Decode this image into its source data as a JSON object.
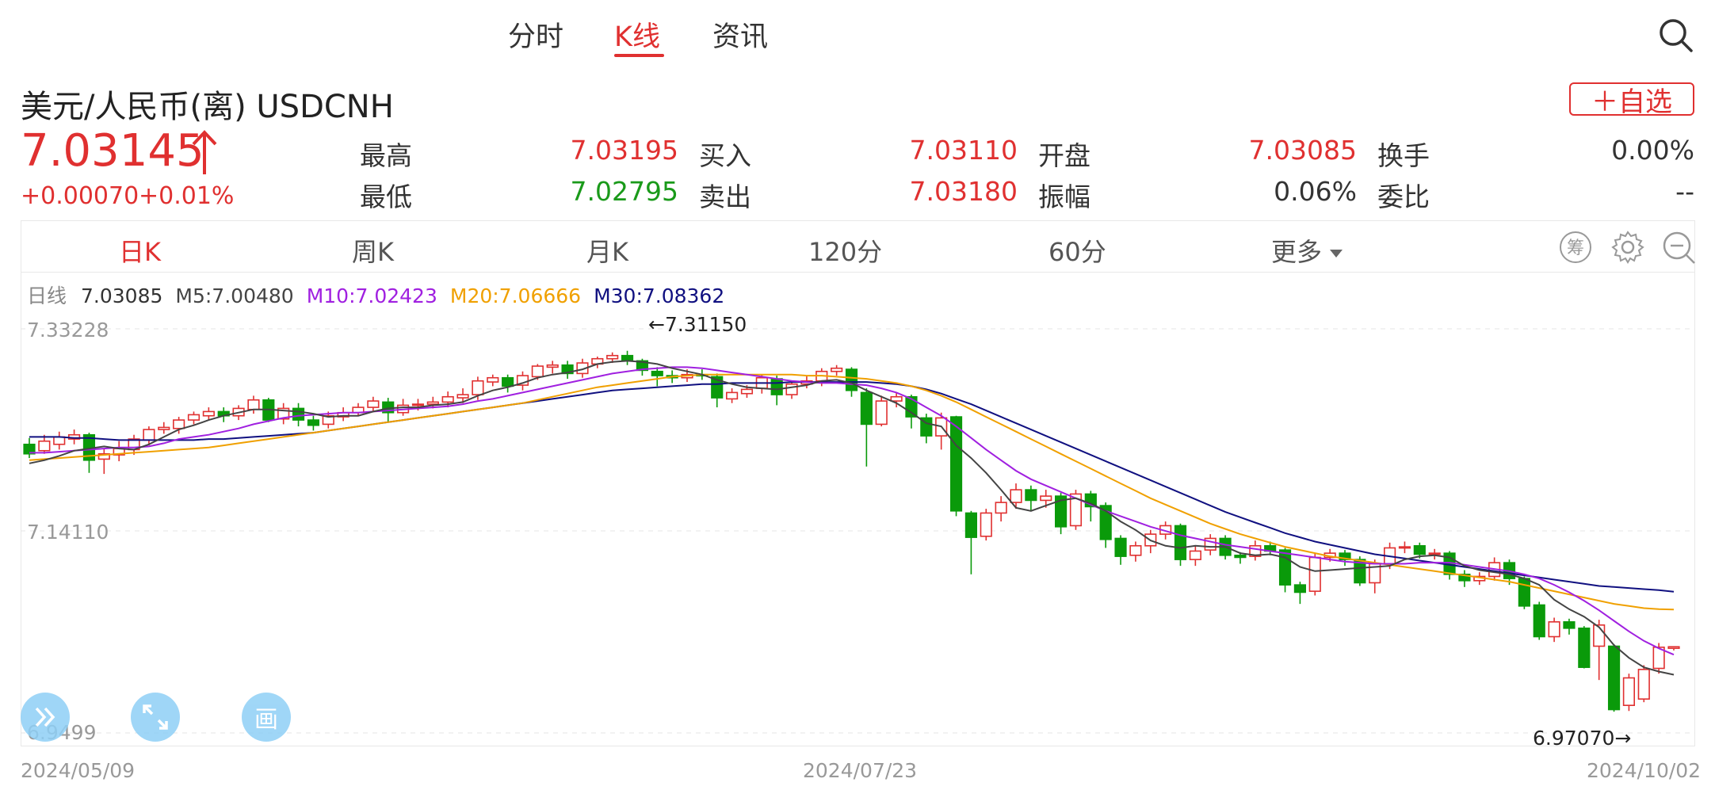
{
  "top_tabs": [
    {
      "label": "分时",
      "active": false
    },
    {
      "label": "K线",
      "active": true
    },
    {
      "label": "资讯",
      "active": false
    }
  ],
  "header": {
    "title": "美元/人民币(离) USDCNH",
    "favorite_label": "＋自选",
    "price": "7.03145",
    "change_abs": "+0.00070",
    "change_pct": "+0.01%"
  },
  "quote": {
    "high": {
      "label": "最高",
      "value": "7.03195"
    },
    "low": {
      "label": "最低",
      "value": "7.02795"
    },
    "bid": {
      "label": "买入",
      "value": "7.03110"
    },
    "ask": {
      "label": "卖出",
      "value": "7.03180"
    },
    "open": {
      "label": "开盘",
      "value": "7.03085"
    },
    "amplitude": {
      "label": "振幅",
      "value": "0.06%"
    },
    "turnover": {
      "label": "换手",
      "value": "0.00%"
    },
    "ratio": {
      "label": "委比",
      "value": "--"
    }
  },
  "periods": [
    {
      "label": "日K",
      "active": true
    },
    {
      "label": "周K",
      "active": false
    },
    {
      "label": "月K",
      "active": false
    },
    {
      "label": "120分",
      "active": false
    },
    {
      "label": "60分",
      "active": false
    },
    {
      "label": "更多",
      "active": false
    }
  ],
  "tools": {
    "chip_icon_text": "筹"
  },
  "ma_legend": {
    "label": "日线",
    "value": "7.03085",
    "m5": "M5:7.00480",
    "m10": "M10:7.02423",
    "m20": "M20:7.06666",
    "m30": "M30:7.08362"
  },
  "colors": {
    "up": "#e03030",
    "down": "#0a9a0a",
    "m5": "#444444",
    "m10": "#a020e0",
    "m20": "#f0a000",
    "m30": "#101080"
  },
  "float_buttons": {
    "draw_label": "画"
  },
  "chart_data": {
    "type": "candlestick",
    "y_top_label": "7.33228",
    "y_mid_label": "7.14110",
    "y_bottom_label": "6.9499",
    "ylim": [
      6.9499,
      7.33228
    ],
    "x_labels": [
      "2024/05/09",
      "2024/07/23",
      "2024/10/02"
    ],
    "max_annotation": "←7.31150",
    "min_annotation": "6.97070→",
    "candles": [
      [
        7.223,
        7.214,
        7.229,
        7.21
      ],
      [
        7.217,
        7.226,
        7.232,
        7.214
      ],
      [
        7.223,
        7.23,
        7.235,
        7.218
      ],
      [
        7.228,
        7.232,
        7.237,
        7.223
      ],
      [
        7.232,
        7.208,
        7.234,
        7.196
      ],
      [
        7.209,
        7.214,
        7.219,
        7.195
      ],
      [
        7.213,
        7.219,
        7.226,
        7.207
      ],
      [
        7.218,
        7.228,
        7.232,
        7.213
      ],
      [
        7.227,
        7.237,
        7.24,
        7.222
      ],
      [
        7.237,
        7.239,
        7.244,
        7.233
      ],
      [
        7.238,
        7.246,
        7.249,
        7.233
      ],
      [
        7.246,
        7.251,
        7.254,
        7.242
      ],
      [
        7.25,
        7.254,
        7.258,
        7.246
      ],
      [
        7.254,
        7.25,
        7.258,
        7.244
      ],
      [
        7.25,
        7.257,
        7.26,
        7.246
      ],
      [
        7.256,
        7.265,
        7.269,
        7.252
      ],
      [
        7.265,
        7.246,
        7.267,
        7.244
      ],
      [
        7.247,
        7.257,
        7.262,
        7.242
      ],
      [
        7.257,
        7.246,
        7.262,
        7.24
      ],
      [
        7.246,
        7.241,
        7.25,
        7.236
      ],
      [
        7.242,
        7.25,
        7.254,
        7.238
      ],
      [
        7.249,
        7.253,
        7.258,
        7.245
      ],
      [
        7.253,
        7.258,
        7.262,
        7.25
      ],
      [
        7.258,
        7.264,
        7.268,
        7.254
      ],
      [
        7.263,
        7.253,
        7.267,
        7.244
      ],
      [
        7.253,
        7.26,
        7.266,
        7.25
      ],
      [
        7.26,
        7.261,
        7.266,
        7.255
      ],
      [
        7.261,
        7.263,
        7.268,
        7.257
      ],
      [
        7.263,
        7.268,
        7.273,
        7.258
      ],
      [
        7.267,
        7.27,
        7.276,
        7.262
      ],
      [
        7.27,
        7.283,
        7.287,
        7.265
      ],
      [
        7.282,
        7.286,
        7.289,
        7.278
      ],
      [
        7.286,
        7.278,
        7.289,
        7.272
      ],
      [
        7.279,
        7.288,
        7.292,
        7.274
      ],
      [
        7.287,
        7.297,
        7.299,
        7.284
      ],
      [
        7.296,
        7.298,
        7.302,
        7.29
      ],
      [
        7.298,
        7.29,
        7.302,
        7.285
      ],
      [
        7.29,
        7.3,
        7.304,
        7.286
      ],
      [
        7.299,
        7.304,
        7.306,
        7.295
      ],
      [
        7.304,
        7.307,
        7.31,
        7.3
      ],
      [
        7.307,
        7.302,
        7.3115,
        7.298
      ],
      [
        7.302,
        7.293,
        7.304,
        7.288
      ],
      [
        7.292,
        7.288,
        7.296,
        7.278
      ],
      [
        7.288,
        7.286,
        7.293,
        7.281
      ],
      [
        7.286,
        7.289,
        7.294,
        7.282
      ],
      [
        7.289,
        7.288,
        7.294,
        7.284
      ],
      [
        7.287,
        7.267,
        7.29,
        7.258
      ],
      [
        7.266,
        7.272,
        7.276,
        7.262
      ],
      [
        7.271,
        7.275,
        7.279,
        7.267
      ],
      [
        7.276,
        7.286,
        7.289,
        7.271
      ],
      [
        7.285,
        7.27,
        7.288,
        7.26
      ],
      [
        7.27,
        7.28,
        7.283,
        7.266
      ],
      [
        7.28,
        7.283,
        7.288,
        7.276
      ],
      [
        7.283,
        7.292,
        7.295,
        7.278
      ],
      [
        7.292,
        7.295,
        7.298,
        7.288
      ],
      [
        7.294,
        7.274,
        7.296,
        7.268
      ],
      [
        7.272,
        7.242,
        7.276,
        7.202
      ],
      [
        7.242,
        7.264,
        7.269,
        7.24
      ],
      [
        7.264,
        7.268,
        7.272,
        7.258
      ],
      [
        7.268,
        7.249,
        7.27,
        7.238
      ],
      [
        7.248,
        7.231,
        7.252,
        7.224
      ],
      [
        7.231,
        7.248,
        7.253,
        7.218
      ],
      [
        7.249,
        7.16,
        7.25,
        7.155
      ],
      [
        7.158,
        7.135,
        7.16,
        7.1
      ],
      [
        7.136,
        7.158,
        7.162,
        7.132
      ],
      [
        7.158,
        7.168,
        7.174,
        7.15
      ],
      [
        7.168,
        7.18,
        7.186,
        7.162
      ],
      [
        7.18,
        7.17,
        7.184,
        7.16
      ],
      [
        7.17,
        7.174,
        7.18,
        7.163
      ],
      [
        7.174,
        7.145,
        7.177,
        7.138
      ],
      [
        7.146,
        7.176,
        7.18,
        7.142
      ],
      [
        7.176,
        7.164,
        7.179,
        7.15
      ],
      [
        7.165,
        7.133,
        7.168,
        7.125
      ],
      [
        7.134,
        7.117,
        7.137,
        7.109
      ],
      [
        7.118,
        7.127,
        7.131,
        7.112
      ],
      [
        7.127,
        7.138,
        7.142,
        7.12
      ],
      [
        7.138,
        7.146,
        7.15,
        7.133
      ],
      [
        7.146,
        7.114,
        7.148,
        7.108
      ],
      [
        7.114,
        7.122,
        7.127,
        7.108
      ],
      [
        7.123,
        7.134,
        7.138,
        7.118
      ],
      [
        7.134,
        7.118,
        7.137,
        7.114
      ],
      [
        7.118,
        7.116,
        7.121,
        7.11
      ],
      [
        7.117,
        7.127,
        7.132,
        7.113
      ],
      [
        7.127,
        7.122,
        7.131,
        7.118
      ],
      [
        7.123,
        7.09,
        7.125,
        7.083
      ],
      [
        7.09,
        7.083,
        7.093,
        7.072
      ],
      [
        7.084,
        7.116,
        7.12,
        7.08
      ],
      [
        7.116,
        7.12,
        7.124,
        7.112
      ],
      [
        7.12,
        7.114,
        7.123,
        7.108
      ],
      [
        7.114,
        7.092,
        7.117,
        7.089
      ],
      [
        7.092,
        7.11,
        7.114,
        7.082
      ],
      [
        7.11,
        7.125,
        7.13,
        7.105
      ],
      [
        7.125,
        7.126,
        7.131,
        7.12
      ],
      [
        7.127,
        7.119,
        7.13,
        7.115
      ],
      [
        7.119,
        7.12,
        7.124,
        7.114
      ],
      [
        7.12,
        7.1,
        7.122,
        7.095
      ],
      [
        7.1,
        7.094,
        7.104,
        7.088
      ],
      [
        7.094,
        7.098,
        7.102,
        7.09
      ],
      [
        7.098,
        7.111,
        7.116,
        7.094
      ],
      [
        7.111,
        7.096,
        7.114,
        7.09
      ],
      [
        7.096,
        7.07,
        7.098,
        7.067
      ],
      [
        7.071,
        7.041,
        7.074,
        7.038
      ],
      [
        7.041,
        7.055,
        7.059,
        7.036
      ],
      [
        7.055,
        7.049,
        7.058,
        7.043
      ],
      [
        7.049,
        7.012,
        7.051,
        7.011
      ],
      [
        7.032,
        7.052,
        7.057,
        7.0
      ],
      [
        7.032,
        6.972,
        7.034,
        6.97
      ],
      [
        6.976,
        7.002,
        7.006,
        6.9707
      ],
      [
        6.982,
        7.01,
        7.014,
        6.979
      ],
      [
        7.011,
        7.031,
        7.035,
        7.006
      ],
      [
        7.03,
        7.03145,
        7.032,
        7.028
      ]
    ],
    "ma5": [
      7.205,
      7.208,
      7.212,
      7.217,
      7.219,
      7.221,
      7.219,
      7.218,
      7.223,
      7.23,
      7.237,
      7.241,
      7.246,
      7.25,
      7.253,
      7.256,
      7.256,
      7.255,
      7.254,
      7.252,
      7.249,
      7.25,
      7.25,
      7.254,
      7.257,
      7.258,
      7.258,
      7.26,
      7.261,
      7.263,
      7.269,
      7.274,
      7.277,
      7.281,
      7.286,
      7.289,
      7.291,
      7.294,
      7.299,
      7.301,
      7.302,
      7.301,
      7.299,
      7.295,
      7.292,
      7.289,
      7.284,
      7.28,
      7.277,
      7.276,
      7.275,
      7.277,
      7.279,
      7.283,
      7.284,
      7.281,
      7.274,
      7.268,
      7.262,
      7.253,
      7.243,
      7.24,
      7.222,
      7.21,
      7.196,
      7.18,
      7.163,
      7.16,
      7.165,
      7.17,
      7.172,
      7.167,
      7.16,
      7.15,
      7.142,
      7.132,
      7.127,
      7.125,
      7.127,
      7.126,
      7.126,
      7.12,
      7.118,
      7.119,
      7.116,
      7.107,
      7.103,
      7.104,
      7.105,
      7.106,
      7.107,
      7.108,
      7.114,
      7.117,
      7.118,
      7.116,
      7.108,
      7.104,
      7.102,
      7.1,
      7.096,
      7.09,
      7.076,
      7.067,
      7.06,
      7.05,
      7.033,
      7.021,
      7.012,
      7.008,
      7.005
    ],
    "ma10": [
      7.215,
      7.215,
      7.216,
      7.217,
      7.218,
      7.219,
      7.22,
      7.22,
      7.221,
      7.224,
      7.228,
      7.23,
      7.232,
      7.235,
      7.238,
      7.242,
      7.245,
      7.248,
      7.25,
      7.251,
      7.252,
      7.253,
      7.253,
      7.254,
      7.255,
      7.256,
      7.257,
      7.258,
      7.259,
      7.261,
      7.264,
      7.266,
      7.269,
      7.272,
      7.275,
      7.278,
      7.281,
      7.284,
      7.287,
      7.29,
      7.292,
      7.294,
      7.295,
      7.296,
      7.296,
      7.295,
      7.293,
      7.291,
      7.289,
      7.287,
      7.285,
      7.283,
      7.282,
      7.281,
      7.281,
      7.28,
      7.279,
      7.276,
      7.272,
      7.266,
      7.258,
      7.25,
      7.24,
      7.229,
      7.218,
      7.208,
      7.198,
      7.19,
      7.184,
      7.178,
      7.172,
      7.166,
      7.16,
      7.155,
      7.15,
      7.145,
      7.141,
      7.137,
      7.134,
      7.131,
      7.128,
      7.126,
      7.124,
      7.122,
      7.12,
      7.118,
      7.116,
      7.114,
      7.112,
      7.111,
      7.11,
      7.11,
      7.11,
      7.111,
      7.111,
      7.111,
      7.109,
      7.107,
      7.105,
      7.103,
      7.1,
      7.096,
      7.09,
      7.083,
      7.075,
      7.066,
      7.056,
      7.046,
      7.037,
      7.03,
      7.024
    ],
    "ma20": [
      7.208,
      7.209,
      7.21,
      7.211,
      7.212,
      7.213,
      7.214,
      7.215,
      7.216,
      7.217,
      7.218,
      7.219,
      7.22,
      7.222,
      7.224,
      7.226,
      7.228,
      7.23,
      7.232,
      7.234,
      7.236,
      7.238,
      7.24,
      7.242,
      7.244,
      7.246,
      7.248,
      7.25,
      7.252,
      7.254,
      7.256,
      7.258,
      7.26,
      7.262,
      7.265,
      7.268,
      7.271,
      7.274,
      7.277,
      7.279,
      7.281,
      7.283,
      7.285,
      7.287,
      7.288,
      7.289,
      7.289,
      7.289,
      7.289,
      7.289,
      7.289,
      7.289,
      7.288,
      7.288,
      7.287,
      7.286,
      7.285,
      7.283,
      7.281,
      7.278,
      7.274,
      7.269,
      7.263,
      7.256,
      7.249,
      7.242,
      7.235,
      7.228,
      7.221,
      7.214,
      7.207,
      7.2,
      7.193,
      7.186,
      7.179,
      7.172,
      7.166,
      7.16,
      7.154,
      7.148,
      7.143,
      7.138,
      7.134,
      7.13,
      7.126,
      7.123,
      7.12,
      7.117,
      7.115,
      7.113,
      7.111,
      7.109,
      7.107,
      7.105,
      7.103,
      7.101,
      7.099,
      7.097,
      7.095,
      7.093,
      7.09,
      7.087,
      7.084,
      7.081,
      7.078,
      7.075,
      7.072,
      7.07,
      7.068,
      7.067,
      7.0667
    ],
    "ma30": [
      7.23,
      7.23,
      7.23,
      7.229,
      7.229,
      7.228,
      7.227,
      7.227,
      7.227,
      7.227,
      7.227,
      7.227,
      7.228,
      7.228,
      7.229,
      7.23,
      7.231,
      7.232,
      7.233,
      7.234,
      7.236,
      7.238,
      7.24,
      7.242,
      7.244,
      7.246,
      7.248,
      7.25,
      7.252,
      7.254,
      7.256,
      7.258,
      7.26,
      7.262,
      7.264,
      7.266,
      7.268,
      7.27,
      7.272,
      7.274,
      7.275,
      7.276,
      7.277,
      7.278,
      7.279,
      7.28,
      7.28,
      7.281,
      7.281,
      7.281,
      7.281,
      7.282,
      7.282,
      7.282,
      7.282,
      7.282,
      7.282,
      7.281,
      7.28,
      7.278,
      7.275,
      7.271,
      7.266,
      7.261,
      7.255,
      7.249,
      7.243,
      7.237,
      7.231,
      7.225,
      7.219,
      7.213,
      7.207,
      7.201,
      7.195,
      7.189,
      7.183,
      7.177,
      7.171,
      7.165,
      7.159,
      7.154,
      7.149,
      7.144,
      7.139,
      7.135,
      7.131,
      7.128,
      7.125,
      7.122,
      7.119,
      7.117,
      7.115,
      7.113,
      7.111,
      7.109,
      7.107,
      7.105,
      7.103,
      7.101,
      7.099,
      7.097,
      7.095,
      7.093,
      7.091,
      7.089,
      7.088,
      7.087,
      7.086,
      7.085,
      7.0836
    ]
  }
}
